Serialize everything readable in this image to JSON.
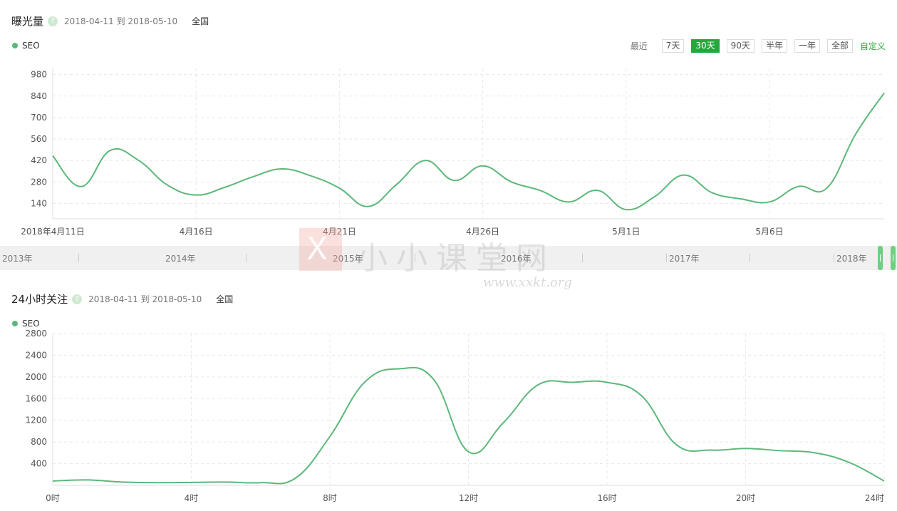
{
  "chart1": {
    "title": "曝光量",
    "help_icon": "?",
    "date_range": "2018-04-11 到 2018-05-10",
    "region": "全国",
    "legend": "SEO",
    "periods_label": "最近",
    "periods": [
      "7天",
      "30天",
      "90天",
      "半年",
      "一年",
      "全部"
    ],
    "active_period": "30天",
    "custom_label": "自定义"
  },
  "chart2": {
    "title": "24小时关注",
    "help_icon": "?",
    "date_range": "2018-04-11 到 2018-05-10",
    "region": "全国",
    "legend": "SEO"
  },
  "slider": {
    "years": [
      "2013年",
      "2014年",
      "2015年",
      "2016年",
      "2017年",
      "2018年"
    ]
  },
  "watermark": {
    "logo_letter": "X",
    "text_cn": "小小课堂网",
    "text_en": "www.xxkt.org"
  },
  "colors": {
    "series": "#5cb87a",
    "accent": "#23a83b"
  },
  "chart_data": [
    {
      "type": "line",
      "xlabel": "",
      "ylabel": "",
      "x_ticks": [
        "2018年4月11日",
        "4月16日",
        "4月21日",
        "4月26日",
        "5月1日",
        "5月6日"
      ],
      "y_ticks": [
        140,
        280,
        420,
        560,
        700,
        840,
        980
      ],
      "ylim": [
        40,
        1020
      ],
      "x": [
        "2018-04-11",
        "2018-04-12",
        "2018-04-13",
        "2018-04-14",
        "2018-04-15",
        "2018-04-16",
        "2018-04-17",
        "2018-04-18",
        "2018-04-19",
        "2018-04-20",
        "2018-04-21",
        "2018-04-22",
        "2018-04-23",
        "2018-04-24",
        "2018-04-25",
        "2018-04-26",
        "2018-04-27",
        "2018-04-28",
        "2018-04-29",
        "2018-04-30",
        "2018-05-01",
        "2018-05-02",
        "2018-05-03",
        "2018-05-04",
        "2018-05-05",
        "2018-05-06",
        "2018-05-07",
        "2018-05-08",
        "2018-05-09",
        "2018-05-10"
      ],
      "series": [
        {
          "name": "SEO",
          "values": [
            450,
            250,
            485,
            420,
            260,
            195,
            245,
            315,
            365,
            320,
            240,
            120,
            265,
            420,
            290,
            385,
            280,
            225,
            150,
            225,
            100,
            185,
            325,
            210,
            170,
            150,
            250,
            240,
            590,
            860
          ]
        }
      ],
      "grid": true
    },
    {
      "type": "line",
      "xlabel": "",
      "ylabel": "",
      "x_ticks": [
        "0时",
        "4时",
        "8时",
        "12时",
        "16时",
        "20时",
        "24时"
      ],
      "y_ticks": [
        400,
        800,
        1200,
        1600,
        2000,
        2400,
        2800
      ],
      "ylim": [
        0,
        2800
      ],
      "x": [
        0,
        1,
        2,
        3,
        4,
        5,
        6,
        7,
        8,
        9,
        10,
        11,
        12,
        13,
        14,
        15,
        16,
        17,
        18,
        19,
        20,
        21,
        22,
        23,
        24
      ],
      "series": [
        {
          "name": "SEO",
          "values": [
            80,
            100,
            60,
            50,
            55,
            60,
            50,
            130,
            900,
            1900,
            2150,
            1950,
            620,
            1150,
            1850,
            1900,
            1900,
            1650,
            750,
            650,
            680,
            640,
            600,
            420,
            80
          ]
        }
      ],
      "grid": true
    }
  ]
}
